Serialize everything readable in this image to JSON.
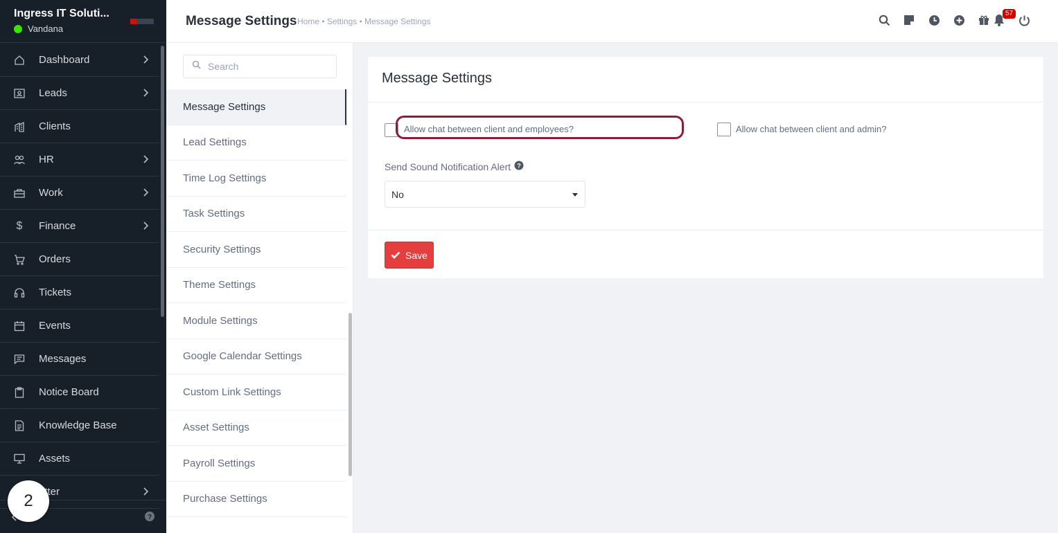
{
  "app": {
    "company": "Ingress IT Soluti...",
    "user": "Vandana",
    "status_color": "#39e500"
  },
  "nav": {
    "items": [
      {
        "label": "Dashboard",
        "icon": "house-icon",
        "has_submenu": true
      },
      {
        "label": "Leads",
        "icon": "id-card-icon",
        "has_submenu": true
      },
      {
        "label": "Clients",
        "icon": "building-icon",
        "has_submenu": false
      },
      {
        "label": "HR",
        "icon": "people-icon",
        "has_submenu": true
      },
      {
        "label": "Work",
        "icon": "briefcase-icon",
        "has_submenu": true
      },
      {
        "label": "Finance",
        "icon": "dollar-icon",
        "has_submenu": true
      },
      {
        "label": "Orders",
        "icon": "cart-icon",
        "has_submenu": false
      },
      {
        "label": "Tickets",
        "icon": "headset-icon",
        "has_submenu": false
      },
      {
        "label": "Events",
        "icon": "calendar-icon",
        "has_submenu": false
      },
      {
        "label": "Messages",
        "icon": "chat-icon",
        "has_submenu": false
      },
      {
        "label": "Notice Board",
        "icon": "clipboard-icon",
        "has_submenu": false
      },
      {
        "label": "Knowledge Base",
        "icon": "document-icon",
        "has_submenu": false
      },
      {
        "label": "Assets",
        "icon": "monitor-icon",
        "has_submenu": false
      },
      {
        "label": "etter",
        "icon": "letter-icon",
        "has_submenu": true
      }
    ],
    "step_badge": "2"
  },
  "header": {
    "title": "Message Settings",
    "breadcrumb": "Home • Settings • Message Settings",
    "notification_count": "57"
  },
  "settings_menu": {
    "search_placeholder": "Search",
    "items": [
      {
        "label": "Message Settings",
        "active": true
      },
      {
        "label": "Lead Settings"
      },
      {
        "label": "Time Log Settings"
      },
      {
        "label": "Task Settings"
      },
      {
        "label": "Security Settings"
      },
      {
        "label": "Theme Settings"
      },
      {
        "label": "Module Settings"
      },
      {
        "label": "Google Calendar Settings"
      },
      {
        "label": "Custom Link Settings"
      },
      {
        "label": "Asset Settings"
      },
      {
        "label": "Payroll Settings"
      },
      {
        "label": "Purchase Settings"
      }
    ]
  },
  "card": {
    "title": "Message Settings",
    "chat_employees_label": "Allow chat between client and employees?",
    "chat_employees_checked": false,
    "chat_admin_label": "Allow chat between client and admin?",
    "chat_admin_checked": false,
    "sound_label": "Send Sound Notification Alert",
    "sound_value": "No",
    "save_label": "Save",
    "highlight_color": "#8b1d37",
    "save_color": "#e53e3e"
  }
}
